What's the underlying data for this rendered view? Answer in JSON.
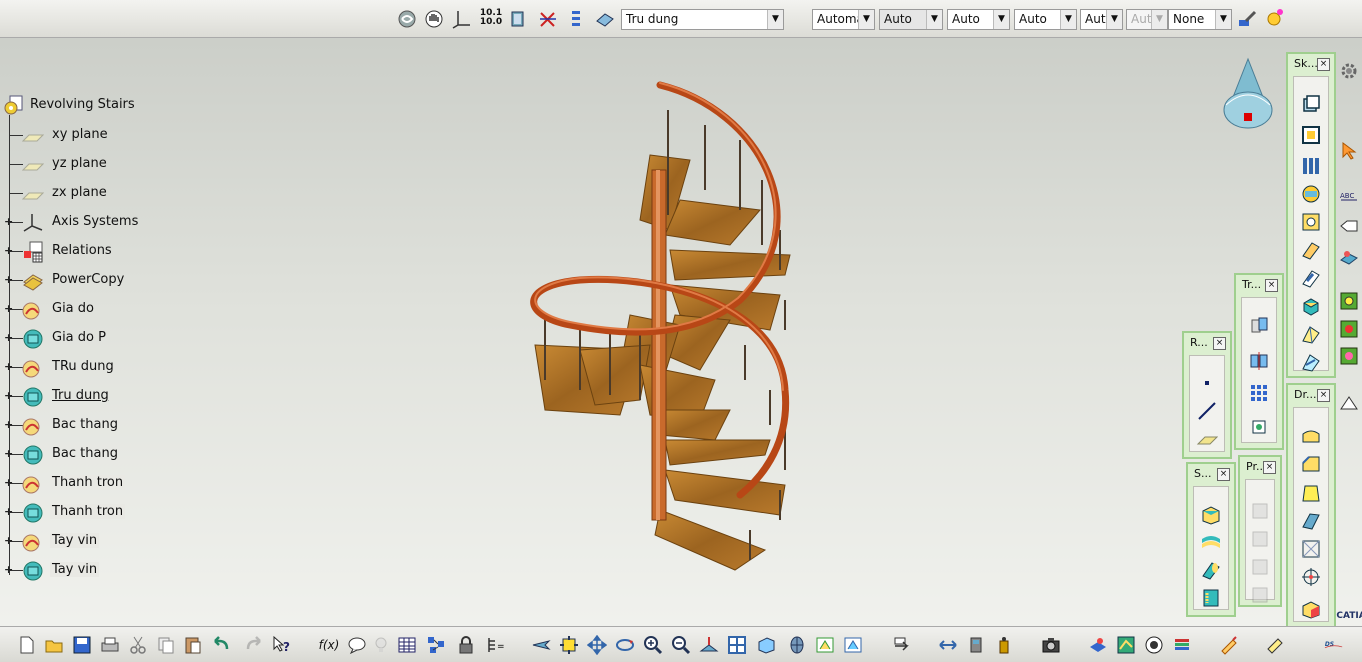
{
  "toolbar_top": {
    "icons": [
      "fly-mode-icon",
      "pan-icon",
      "axis-icon",
      "measure-icon",
      "view-icon",
      "snap-icon",
      "list-icon",
      "layer-icon"
    ],
    "measure_label_a": "10.1",
    "measure_label_b": "10.0",
    "current_body": "Tru dung",
    "properties": [
      "Automa",
      "Auto",
      "Auto",
      "Auto",
      "Aut",
      "Aut",
      "None"
    ]
  },
  "tree": {
    "root": "Revolving Stairs",
    "items": [
      {
        "label": "xy plane"
      },
      {
        "label": "yz plane"
      },
      {
        "label": "zx plane"
      },
      {
        "label": "Axis Systems"
      },
      {
        "label": "Relations"
      },
      {
        "label": "PowerCopy"
      },
      {
        "label": "Gia do"
      },
      {
        "label": "Gia do P"
      },
      {
        "label": "TRu dung"
      },
      {
        "label": "Tru dung"
      },
      {
        "label": "Bac thang"
      },
      {
        "label": "Bac thang"
      },
      {
        "label": "Thanh tron"
      },
      {
        "label": "Thanh tron"
      },
      {
        "label": "Tay vin"
      },
      {
        "label": "Tay vin"
      }
    ]
  },
  "panels": {
    "sketcher": "Sk...",
    "transform": "Tr...",
    "reference": "R...",
    "surfaces": "S...",
    "product": "Pr...",
    "dress": "Dr..."
  },
  "colors": {
    "stair_wood": "#a86b22",
    "handrail": "#c4521f",
    "panel_bg": "#dcefd0",
    "panel_border": "#9fcf8e"
  },
  "brand": "CATIA"
}
